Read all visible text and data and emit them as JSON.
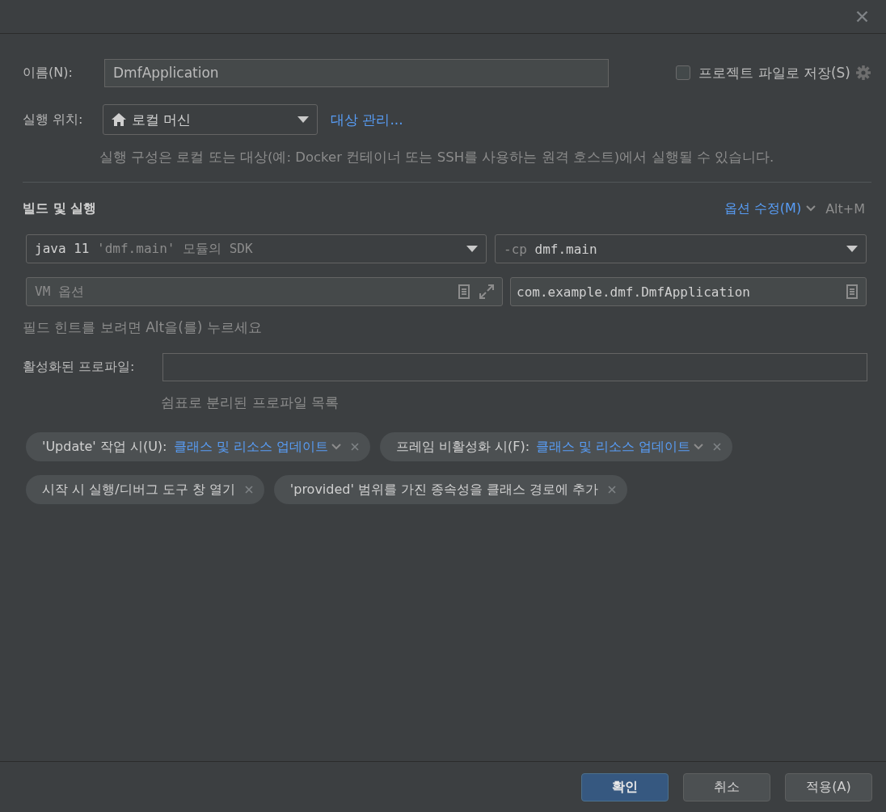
{
  "name_field": {
    "label": "이름(N):",
    "value": "DmfApplication"
  },
  "store_as_project_file": {
    "label": "프로젝트 파일로 저장(S)",
    "checked": false
  },
  "run_on": {
    "label": "실행 위치:",
    "value": "로컬 머신",
    "manage_link": "대상 관리...",
    "hint": "실행 구성은 로컬 또는 대상(예: Docker 컨테이너 또는 SSH를 사용하는 원격 호스트)에서 실행될 수 있습니다."
  },
  "build_section": {
    "title": "빌드 및 실행",
    "modify_options": "옵션 수정(M)",
    "shortcut": "Alt+M",
    "jdk": {
      "value": "java 11",
      "detail": "'dmf.main' 모듈의 SDK"
    },
    "classpath": {
      "prefix": "-cp",
      "value": "dmf.main"
    },
    "vm_options": {
      "placeholder": "VM 옵션"
    },
    "main_class": {
      "value": "com.example.dmf.DmfApplication"
    },
    "hint": "필드 힌트를 보려면 Alt을(를) 누르세요"
  },
  "active_profiles": {
    "label": "활성화된 프로파일:",
    "hint": "쉼표로 분리된 프로파일 목록"
  },
  "option_chips": [
    {
      "kind": "select",
      "label": "'Update' 작업 시(U):",
      "value": "클래스 및 리소스 업데이트"
    },
    {
      "kind": "select",
      "label": "프레임 비활성화 시(F):",
      "value": "클래스 및 리소스 업데이트"
    },
    {
      "kind": "plain",
      "label": "시작 시 실행/디버그 도구 창 열기"
    },
    {
      "kind": "plain",
      "label": "'provided' 범위를 가진 종속성을 클래스 경로에 추가"
    }
  ],
  "buttons": [
    {
      "label": "확인",
      "default": true
    },
    {
      "label": "취소",
      "default": false
    },
    {
      "label": "적용(A)",
      "default": false
    }
  ]
}
